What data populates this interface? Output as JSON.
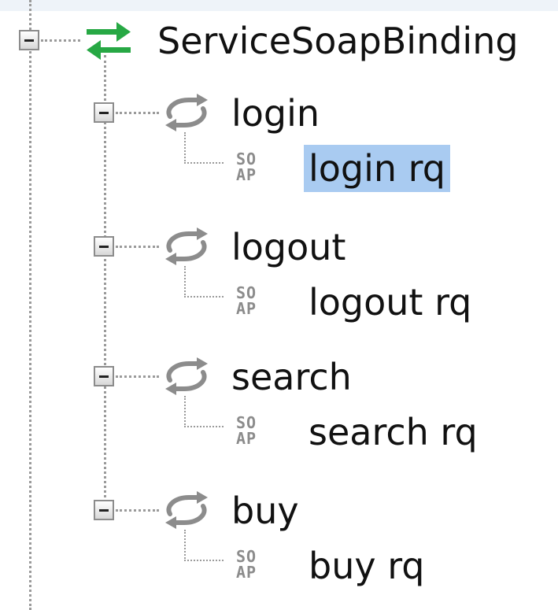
{
  "tree": {
    "binding": {
      "label": "ServiceSoapBinding",
      "icon": "binding-arrows-icon",
      "icon_colors": [
        "#27a844",
        "#27a844"
      ],
      "expanded": true,
      "operations": [
        {
          "label": "login",
          "icon": "operation-cycle-icon",
          "request": {
            "label": "login rq",
            "icon": "soap-request-icon",
            "selected": true
          }
        },
        {
          "label": "logout",
          "icon": "operation-cycle-icon",
          "request": {
            "label": "logout rq",
            "icon": "soap-request-icon",
            "selected": false
          }
        },
        {
          "label": "search",
          "icon": "operation-cycle-icon",
          "request": {
            "label": "search rq",
            "icon": "soap-request-icon",
            "selected": false
          }
        },
        {
          "label": "buy",
          "icon": "operation-cycle-icon",
          "request": {
            "label": "buy rq",
            "icon": "soap-request-icon",
            "selected": false
          }
        }
      ]
    },
    "soap_icon_text": {
      "top": "SO",
      "bottom": "AP"
    }
  },
  "colors": {
    "selection": "#a9cbf1",
    "tree_line": "#9a9a9a",
    "icon_gray": "#8c8c8c",
    "binding_green": "#27a844"
  }
}
